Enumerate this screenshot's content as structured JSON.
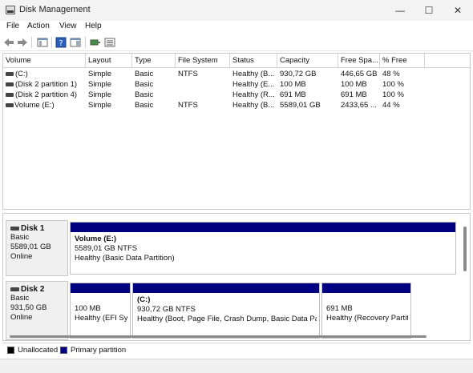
{
  "window": {
    "title": "Disk Management",
    "controls": {
      "minimize": "—",
      "maximize": "☐",
      "close": "✕"
    }
  },
  "menu": [
    "File",
    "Action",
    "View",
    "Help"
  ],
  "toolbar": {
    "icons": [
      "back-arrow-icon",
      "forward-arrow-icon",
      "console-tree-icon",
      "properties-icon",
      "help-icon",
      "show-hide-icon",
      "connect-icon",
      "list-view-icon"
    ]
  },
  "volume_list": {
    "columns": [
      "Volume",
      "Layout",
      "Type",
      "File System",
      "Status",
      "Capacity",
      "Free Spa...",
      "% Free"
    ],
    "rows": [
      [
        "(C:)",
        "Simple",
        "Basic",
        "NTFS",
        "Healthy (B...",
        "930,72 GB",
        "446,65 GB",
        "48 %"
      ],
      [
        "(Disk 2 partition 1)",
        "Simple",
        "Basic",
        "",
        "Healthy (E...",
        "100 MB",
        "100 MB",
        "100 %"
      ],
      [
        "(Disk 2 partition 4)",
        "Simple",
        "Basic",
        "",
        "Healthy (R...",
        "691 MB",
        "691 MB",
        "100 %"
      ],
      [
        "Volume (E:)",
        "Simple",
        "Basic",
        "NTFS",
        "Healthy (B...",
        "5589,01 GB",
        "2433,65 ...",
        "44 %"
      ]
    ]
  },
  "disks": [
    {
      "name": "Disk 1",
      "type": "Basic",
      "size": "5589,01 GB",
      "status": "Online",
      "partitions": [
        {
          "name": "Volume  (E:)",
          "size": "5589,01 GB NTFS",
          "status": "Healthy (Basic Data Partition)"
        }
      ]
    },
    {
      "name": "Disk 2",
      "type": "Basic",
      "size": "931,50 GB",
      "status": "Online",
      "partitions": [
        {
          "name": "",
          "size": "100 MB",
          "status": "Healthy (EFI Sys"
        },
        {
          "name": "(C:)",
          "size": "930,72 GB NTFS",
          "status": "Healthy (Boot, Page File, Crash Dump, Basic Data Parti"
        },
        {
          "name": "",
          "size": "691 MB",
          "status": "Healthy (Recovery Partit"
        }
      ]
    }
  ],
  "legend": [
    {
      "label": "Unallocated",
      "color": "#000000"
    },
    {
      "label": "Primary partition",
      "color": "#010080"
    }
  ],
  "colors": {
    "primary_partition": "#010080",
    "unallocated": "#000000"
  }
}
